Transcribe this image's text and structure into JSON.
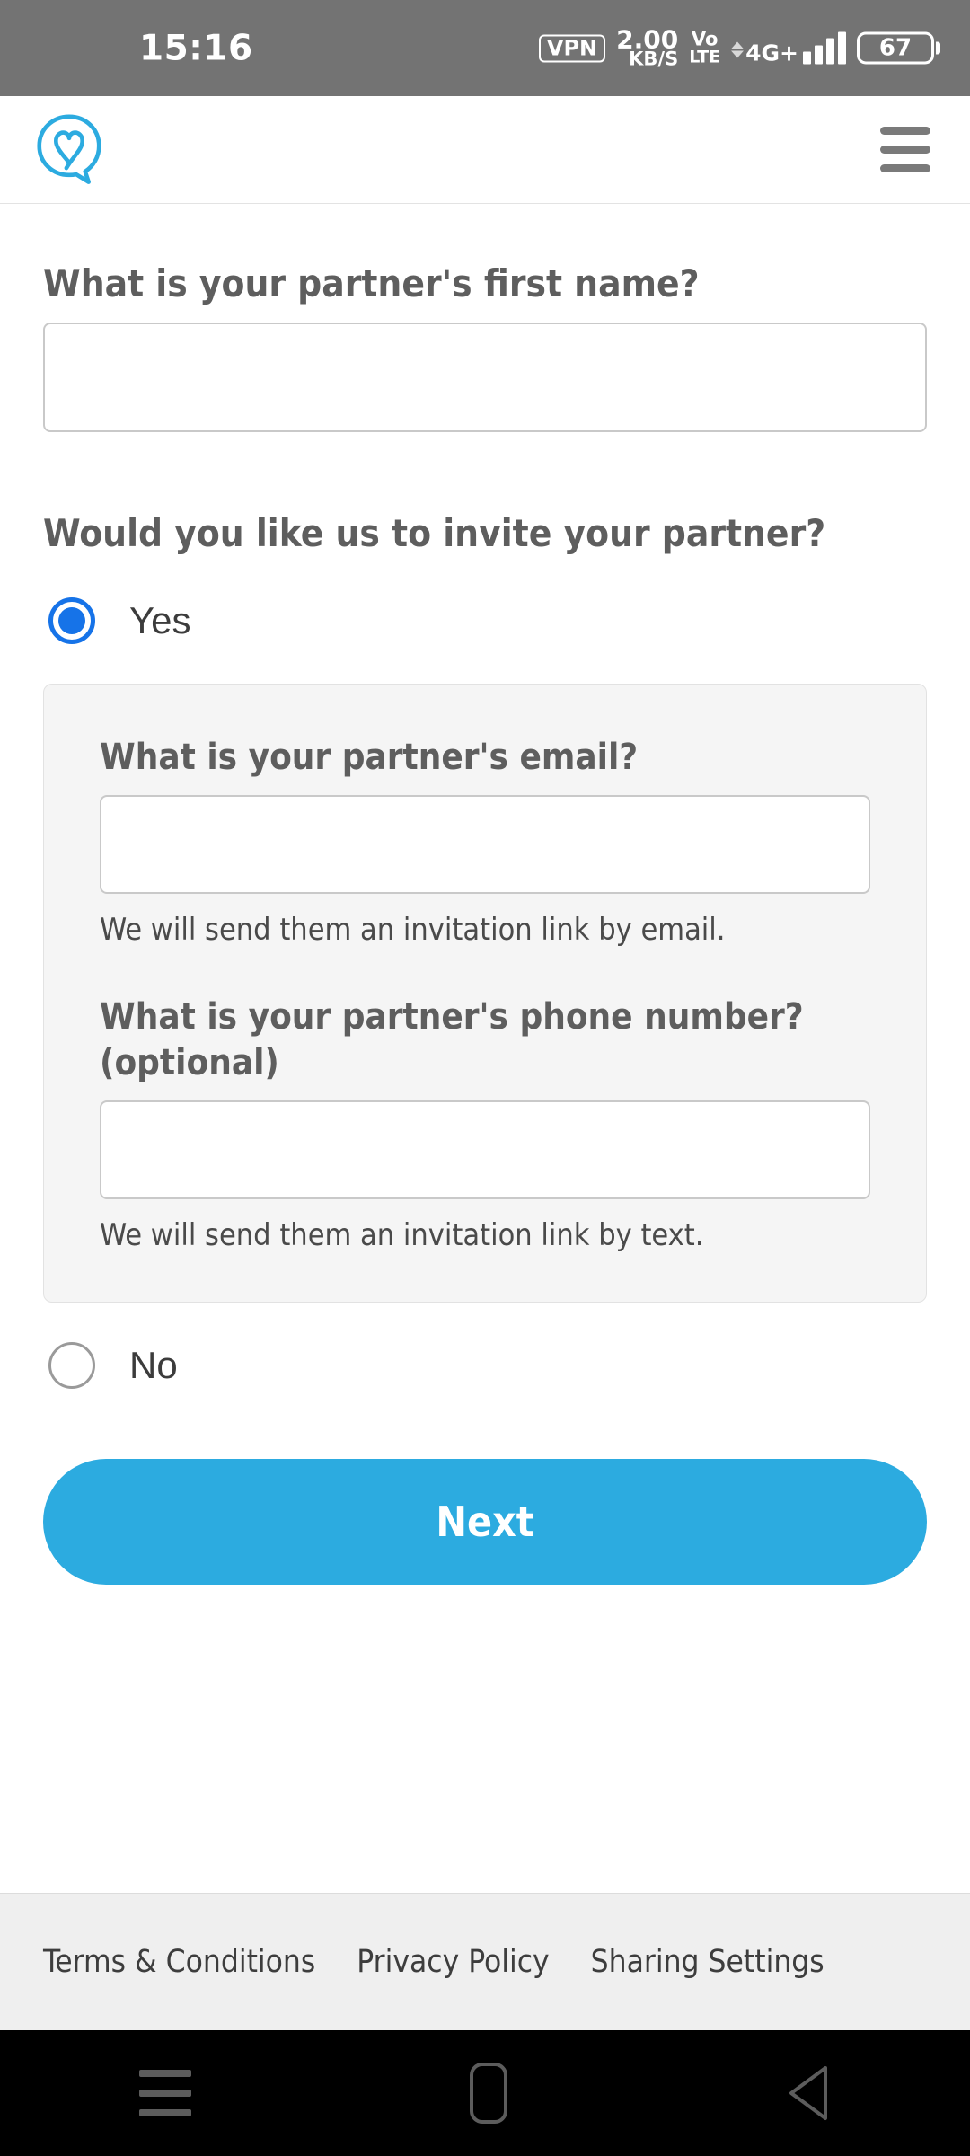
{
  "statusbar": {
    "clock": "15:16",
    "vpn": "VPN",
    "netspeed_value": "2.00",
    "netspeed_unit": "KB/S",
    "volte_line1": "Vo",
    "volte_line2": "LTE",
    "network": "4G+",
    "battery": "67"
  },
  "header": {
    "logo_name": "heart-speech-bubble-logo",
    "menu_name": "hamburger-menu"
  },
  "form": {
    "first_name_question": "What is your partner's first name?",
    "first_name_value": "",
    "first_name_placeholder": "",
    "invite_question": "Would you like us to invite your partner?",
    "options": [
      {
        "label": "Yes",
        "selected": true
      },
      {
        "label": "No",
        "selected": false
      }
    ],
    "panel": {
      "email_question": "What is your partner's email?",
      "email_value": "",
      "email_placeholder": "",
      "email_helper": "We will send them an invitation link by email.",
      "phone_question": "What is your partner's phone number? (optional)",
      "phone_value": "",
      "phone_placeholder": "",
      "phone_helper": "We will send them an invitation link by text."
    },
    "next_label": "Next"
  },
  "footer": {
    "links": [
      "Terms & Conditions",
      "Privacy Policy",
      "Sharing Settings"
    ]
  },
  "navbar": {
    "recents": "recents-button",
    "home": "home-button",
    "back": "back-button"
  },
  "colors": {
    "accent": "#2cabe0",
    "radio_selected": "#1673e8",
    "text": "#5e5e5e",
    "statusbar_bg": "#737373",
    "panel_bg": "#f5f5f5",
    "footer_bg": "#efefef"
  }
}
